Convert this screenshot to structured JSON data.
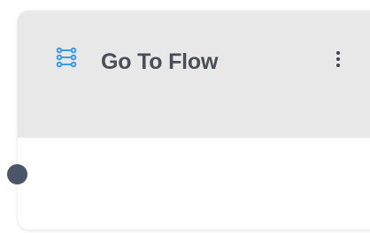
{
  "node": {
    "title": "Go To Flow",
    "icon": "flow-icon",
    "menu_icon": "kebab-menu-icon",
    "colors": {
      "header_bg": "#e8e8e8",
      "icon_blue": "#3b9be8",
      "title_text": "#4a4e55",
      "handle": "#4a5568"
    }
  }
}
